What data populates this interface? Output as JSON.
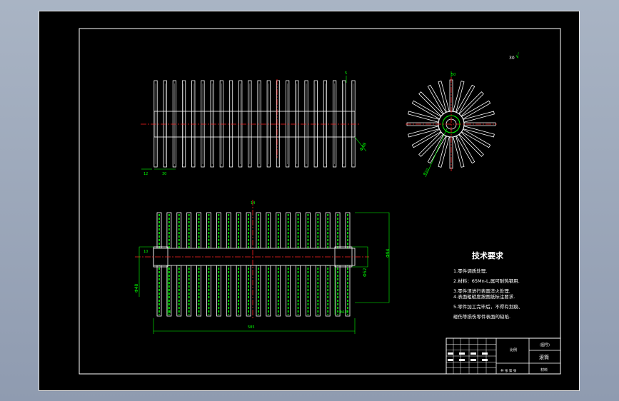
{
  "colors": {
    "background": "#000000",
    "frame": "#ffffff",
    "geometry": "#ffffff",
    "dimension": "#00ff00",
    "centerline": "#ff2020",
    "text": "#ffffff"
  },
  "drawing": {
    "top_view": {
      "bar_count": 22,
      "dims": {
        "dia_note": "Φ48",
        "left_small": "12",
        "left_len": "30",
        "end_mark": "5"
      }
    },
    "end_view": {
      "spoke_count": 24,
      "dims": {
        "top": "50",
        "radial": "Φ10",
        "diag": "Φ20"
      }
    },
    "front_view": {
      "bar_count": 20,
      "dims": {
        "center_top": "14",
        "left_vert": "Φ48",
        "right_vert": "Φ52",
        "outer_right": "Φ94",
        "bottom_left": "8",
        "bottom_right": "Φ4.5",
        "overall_len": "585",
        "left_mark": "10"
      }
    },
    "corner_mark": "30",
    "roughness": "√"
  },
  "tech_req": {
    "title": "技术要求",
    "items": [
      "1.零件调质处理.",
      "2.材料：65Mn-L,属可耐热钢用.",
      "3.零件须进行表面淬火处理.",
      "4.表面粗糙度按图纸标注要求.",
      "5.零件加工完毕后，不得有划痕、",
      "碰伤等损伤零件表面的缺陷."
    ]
  },
  "title_block": {
    "scale_label": "比例",
    "part_name": "滚筒",
    "code_label": "(图号)",
    "material_label": "材料",
    "sheet_label": "共 张 第 张"
  }
}
